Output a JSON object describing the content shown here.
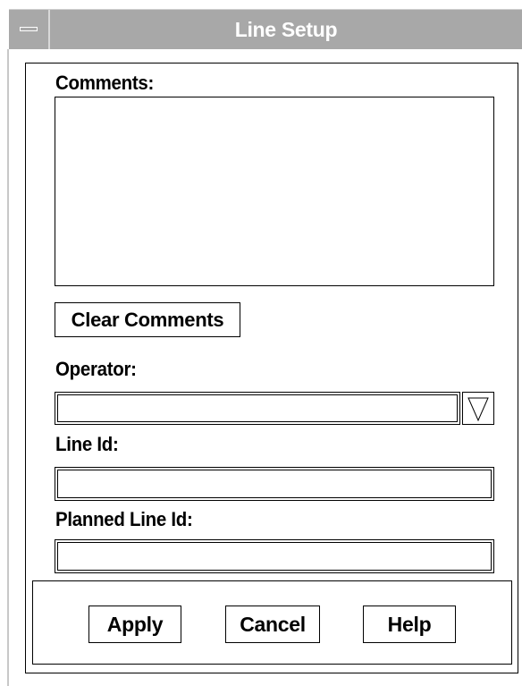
{
  "window": {
    "title": "Line Setup"
  },
  "fields": {
    "comments_label": "Comments:",
    "comments_value": "",
    "clear_comments_label": "Clear Comments",
    "operator_label": "Operator:",
    "operator_value": "",
    "line_id_label": "Line Id:",
    "line_id_value": "",
    "planned_line_id_label": "Planned Line Id:",
    "planned_line_id_value": ""
  },
  "buttons": {
    "apply": "Apply",
    "cancel": "Cancel",
    "help": "Help"
  },
  "icons": {
    "system_menu": "window-menu-icon",
    "dropdown": "triangle-down-icon"
  },
  "colors": {
    "titlebar": "#a8a8a8",
    "title_text": "#ffffff"
  }
}
